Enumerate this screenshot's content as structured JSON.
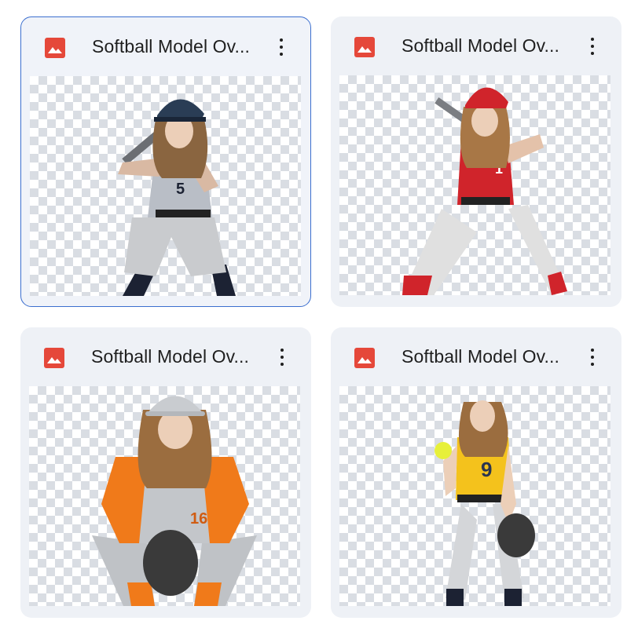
{
  "files": [
    {
      "title": "Softball Model Ov...",
      "icon": "image-file-icon",
      "selected": true,
      "jersey_number": "5",
      "thumbnail": "batter-gray-uniform"
    },
    {
      "title": "Softball Model Ov...",
      "icon": "image-file-icon",
      "selected": false,
      "jersey_number": "1",
      "thumbnail": "batter-red-uniform"
    },
    {
      "title": "Softball Model Ov...",
      "icon": "image-file-icon",
      "selected": false,
      "jersey_number": "16",
      "thumbnail": "catcher-orange-uniform"
    },
    {
      "title": "Softball Model Ov...",
      "icon": "image-file-icon",
      "selected": false,
      "jersey_number": "9",
      "thumbnail": "pitcher-yellow-uniform"
    }
  ],
  "colors": {
    "icon_red": "#e5483a",
    "selected_border": "#3c6fcf",
    "card_bg": "#eef1f6"
  }
}
